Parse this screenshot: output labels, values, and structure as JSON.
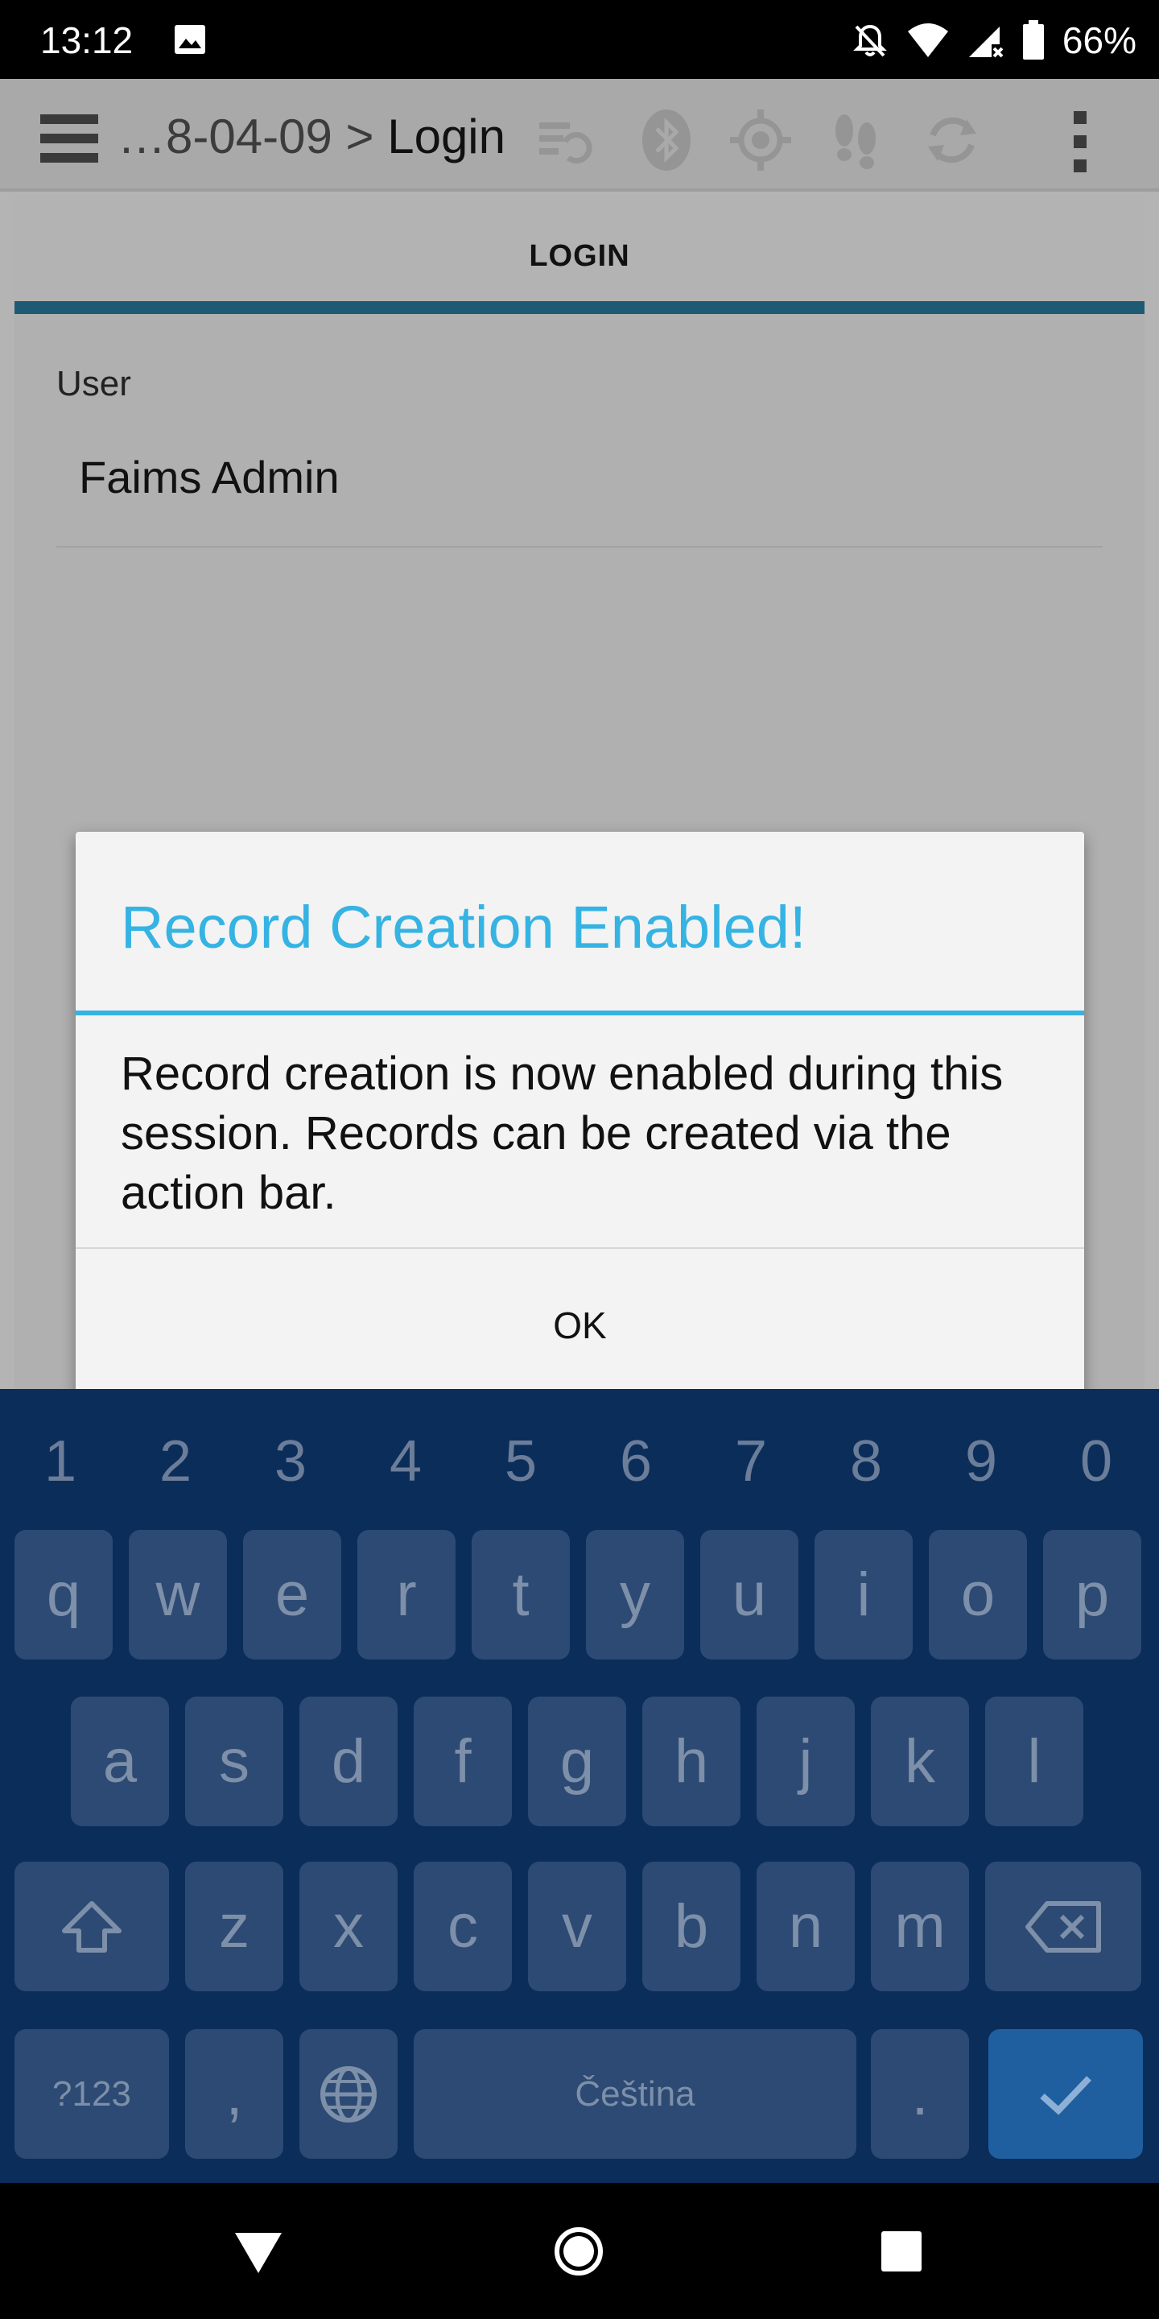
{
  "status_bar": {
    "time": "13:12",
    "battery_percent": "66%",
    "icons": [
      "gallery-icon",
      "notifications-off-icon",
      "wifi-icon",
      "cell-signal-icon",
      "battery-icon"
    ]
  },
  "app_bar": {
    "breadcrumb_prefix": "…8-04-09",
    "breadcrumb_separator": ">",
    "breadcrumb_current": "Login",
    "icons": [
      "menu-icon",
      "sync-status-icon",
      "bluetooth-icon",
      "gps-icon",
      "tracking-icon",
      "sync-icon",
      "overflow-menu-icon"
    ]
  },
  "tabs": [
    {
      "label": "LOGIN",
      "active": true
    }
  ],
  "form": {
    "user_label": "User",
    "user_value": "Faims Admin"
  },
  "dialog": {
    "title": "Record Creation Enabled!",
    "message": "Record creation is now enabled during this session. Records can be created via the action bar.",
    "ok_label": "OK"
  },
  "keyboard": {
    "number_row": [
      "1",
      "2",
      "3",
      "4",
      "5",
      "6",
      "7",
      "8",
      "9",
      "0"
    ],
    "row1": [
      "q",
      "w",
      "e",
      "r",
      "t",
      "y",
      "u",
      "i",
      "o",
      "p"
    ],
    "row2": [
      "a",
      "s",
      "d",
      "f",
      "g",
      "h",
      "j",
      "k",
      "l"
    ],
    "row3": [
      "z",
      "x",
      "c",
      "v",
      "b",
      "n",
      "m"
    ],
    "symbols_label": "?123",
    "comma_label": ",",
    "space_label": "Čeština",
    "period_label": "."
  },
  "colors": {
    "accent": "#35b3e3",
    "keyboard_bg": "#0b2d5a",
    "key_bg": "#2c4a73",
    "enter_key": "#1f5fa0"
  }
}
